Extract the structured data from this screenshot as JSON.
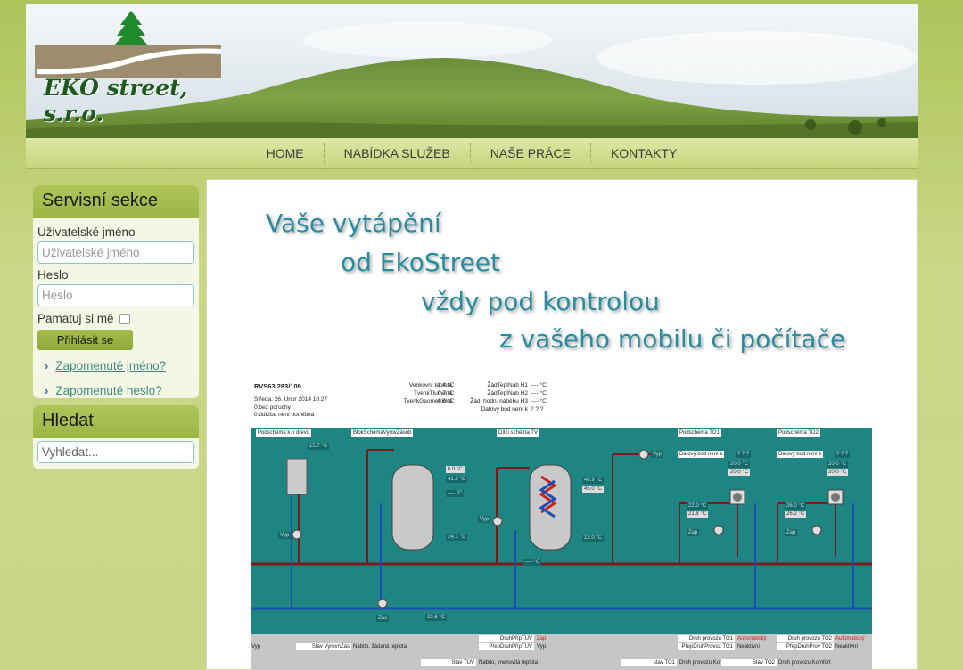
{
  "logo": {
    "text": "EKO street, s.r.o."
  },
  "nav": {
    "items": [
      "HOME",
      "NABÍDKA SLUŽEB",
      "NAŠE PRÁCE",
      "KONTAKTY"
    ]
  },
  "login": {
    "title": "Servisní sekce",
    "username_label": "Uživatelské jméno",
    "username_placeholder": "Uživatelské jméno",
    "password_label": "Heslo",
    "password_placeholder": "Heslo",
    "remember_label": "Pamatuj si mě",
    "submit_label": "Přihlásit se",
    "forgot_username": "Zapomenuté jméno?",
    "forgot_password": "Zapomenuté heslo?"
  },
  "search": {
    "title": "Hledat",
    "placeholder": "Vyhledat..."
  },
  "slogan": [
    "Vaše vytápění",
    "od EkoStreet",
    "vždy pod kontrolou",
    "z vašeho mobilu či počítače"
  ],
  "scada": {
    "device": "RVS63.283/109",
    "date": "Středa, 26. Únor 2014 10:27",
    "status1": "0:bez poruchy",
    "status2": "0:údržba není potřebná",
    "readings": [
      {
        "label": "Venkovní teplota",
        "value": "1.4 °C"
      },
      {
        "label": "TvenkTlumená",
        "value": "0.7 °C"
      },
      {
        "label": "TvenkGeometrická",
        "value": "0.6 °C"
      }
    ],
    "setpoints": [
      {
        "label": "ŽádTepINáb H1",
        "value": "---- °C"
      },
      {
        "label": "ŽádTepINáb H2",
        "value": "---- °C"
      },
      {
        "label": "Žád. hodn. náběhu H3",
        "value": "---- °C"
      },
      {
        "label": "Datový bod není k",
        "value": "? ? ?"
      }
    ],
    "sections": [
      "Podschéma k.n dřevo",
      "BlokSchémaVyrovZásob",
      "Dílčí schéma TV",
      "Podschéma TO1",
      "Podschéma TO2"
    ],
    "values": [
      "15.7 °C",
      "0.0 °C",
      "41.2 °C",
      "---- °C",
      "24.1 °C",
      "48.9 °C",
      "45.0 °C",
      "12.0 °C",
      "---- °C",
      "22.0 °C",
      "21.8 °C",
      "20.0 °C",
      "20.0 °C",
      "26.0 °C",
      "26.2 °C",
      "20.0 °C",
      "20.0 °C",
      "22.6 °C"
    ],
    "datapoint_na": "Datový bod není k",
    "qmarks": "? ? ?",
    "vyp": "Vyp",
    "zap": "Zap",
    "zas": "Zás",
    "bottom": {
      "vyp": "Vyp",
      "stav_vyrov_label": "Stav VyrovnZás",
      "stav_vyrov_value": "Nabito, žádaná teplota",
      "druh_tuv_label": "DruhPřípTUV",
      "druh_tuv_value": "Zap",
      "prep_tuv_label": "PřepDruhPřípTUV",
      "prep_tuv_value": "Vyp",
      "stav_tuv_label": "Stav TUV",
      "stav_tuv_value": "Nabito, jmenovitá teplota",
      "druh_to1_label": "Druh provozu TO1",
      "druh_to1_value": "Automatický",
      "prep_to1_label": "PřepDruhProvoz TO1",
      "prep_to1_value": "Neaktivní",
      "stav_to1_label": "stav TO1",
      "stav_to1_value": "Druh provozu Kon",
      "druh_to2_label": "Druh provozu TO2",
      "druh_to2_value": "Automatický",
      "prep_to2_label": "PřepDruhProv TO2",
      "prep_to2_value": "Neaktivní",
      "stav_to2_label": "Stav TO2",
      "stav_to2_value": "Druh provozu Komfort"
    }
  }
}
